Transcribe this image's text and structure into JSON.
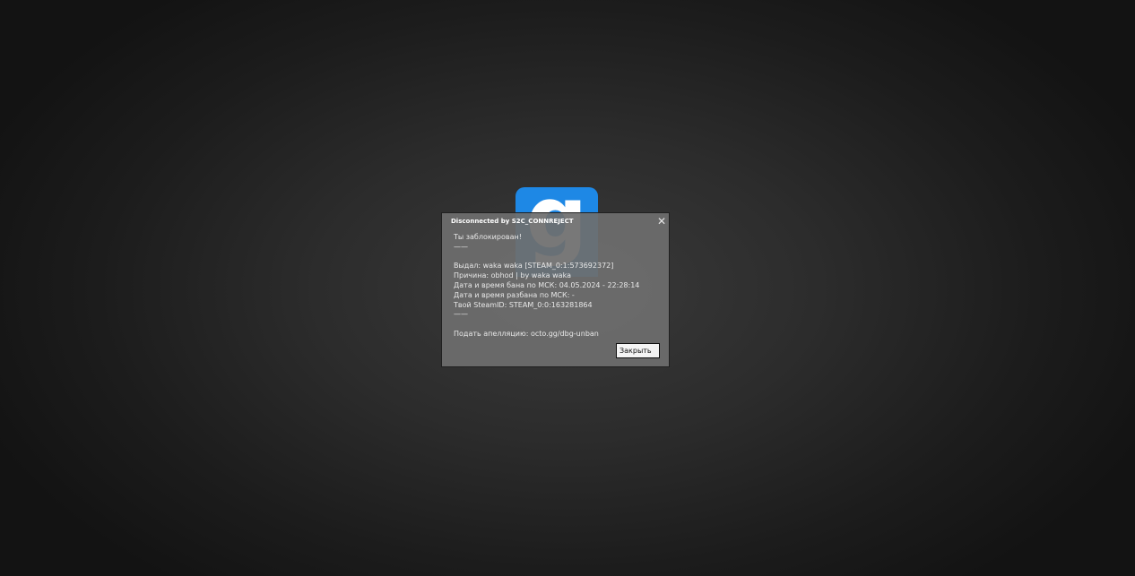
{
  "logo": {
    "glyph": "g",
    "color": "#1e88e5"
  },
  "dialog": {
    "title": "Disconnected by S2C_CONNREJECT",
    "close_icon": "close-icon",
    "lines": [
      "Ты заблокирован!",
      "——",
      "",
      "Выдал: waka waka [STEAM_0:1:573692372]",
      "Причина: obhod | by waka waka",
      "Дата и время бана по МСК: 04.05.2024 - 22:28:14",
      "Дата и время разбана по МСК: -",
      "Твой SteamID: STEAM_0:0:163281864",
      "——",
      "",
      "Подать апелляцию: octo.gg/dbg-unban"
    ],
    "close_button_label": "Закрыть"
  }
}
